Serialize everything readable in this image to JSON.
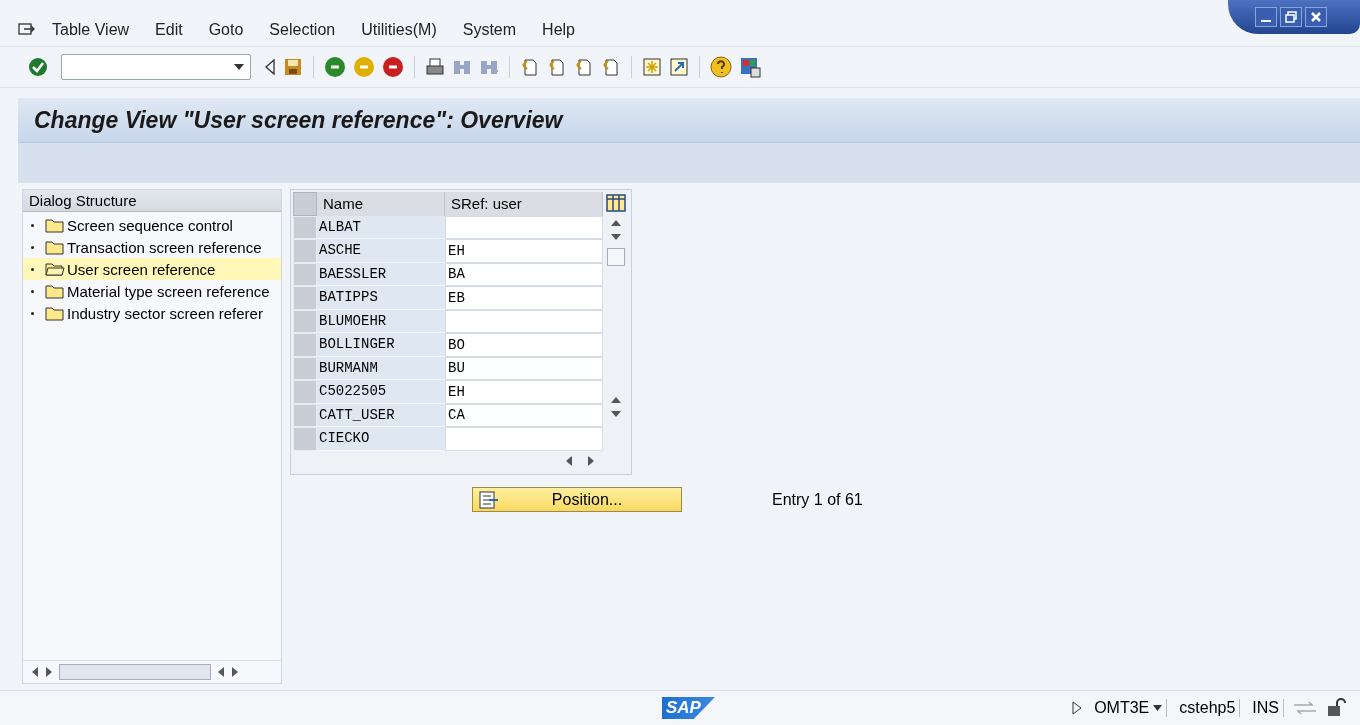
{
  "menu": [
    "Table View",
    "Edit",
    "Goto",
    "Selection",
    "Utilities(M)",
    "System",
    "Help"
  ],
  "title": "Change View \"User screen reference\": Overview",
  "dialog_structure": {
    "heading": "Dialog Structure",
    "items": [
      {
        "label": "Screen sequence control",
        "selected": false
      },
      {
        "label": "Transaction screen reference",
        "selected": false
      },
      {
        "label": "User screen reference",
        "selected": true
      },
      {
        "label": "Material type screen reference",
        "selected": false
      },
      {
        "label": "Industry sector screen referer",
        "selected": false
      }
    ]
  },
  "table": {
    "columns": [
      "Name",
      "SRef: user"
    ],
    "rows": [
      {
        "name": "ALBAT",
        "sref": ""
      },
      {
        "name": "ASCHE",
        "sref": "EH"
      },
      {
        "name": "BAESSLER",
        "sref": "BA"
      },
      {
        "name": "BATIPPS",
        "sref": "EB"
      },
      {
        "name": "BLUMOEHR",
        "sref": ""
      },
      {
        "name": "BOLLINGER",
        "sref": "BO"
      },
      {
        "name": "BURMANM",
        "sref": "BU"
      },
      {
        "name": "C5022505",
        "sref": "EH"
      },
      {
        "name": "CATT_USER",
        "sref": "CA"
      },
      {
        "name": "CIECKO",
        "sref": ""
      }
    ]
  },
  "position_button": "Position...",
  "entry_info": "Entry 1 of 61",
  "status_bar": {
    "logo": "SAP",
    "system": "OMT3E",
    "server": "cstehp5",
    "mode": "INS"
  }
}
